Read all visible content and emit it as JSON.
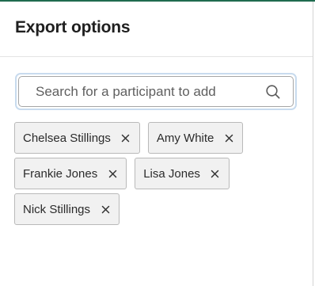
{
  "header": {
    "title": "Export options"
  },
  "search": {
    "placeholder": "Search for a participant to add",
    "value": ""
  },
  "participants": [
    {
      "name": "Chelsea Stillings"
    },
    {
      "name": "Amy White"
    },
    {
      "name": "Frankie Jones"
    },
    {
      "name": "Lisa Jones"
    },
    {
      "name": "Nick Stillings"
    }
  ],
  "icons": {
    "search": "search-icon",
    "remove": "close-icon"
  },
  "colors": {
    "accent_top": "#1f6b4f",
    "focus_ring": "#c8dbee",
    "chip_bg": "#f1f1f1",
    "chip_border": "#b9b9b9"
  }
}
